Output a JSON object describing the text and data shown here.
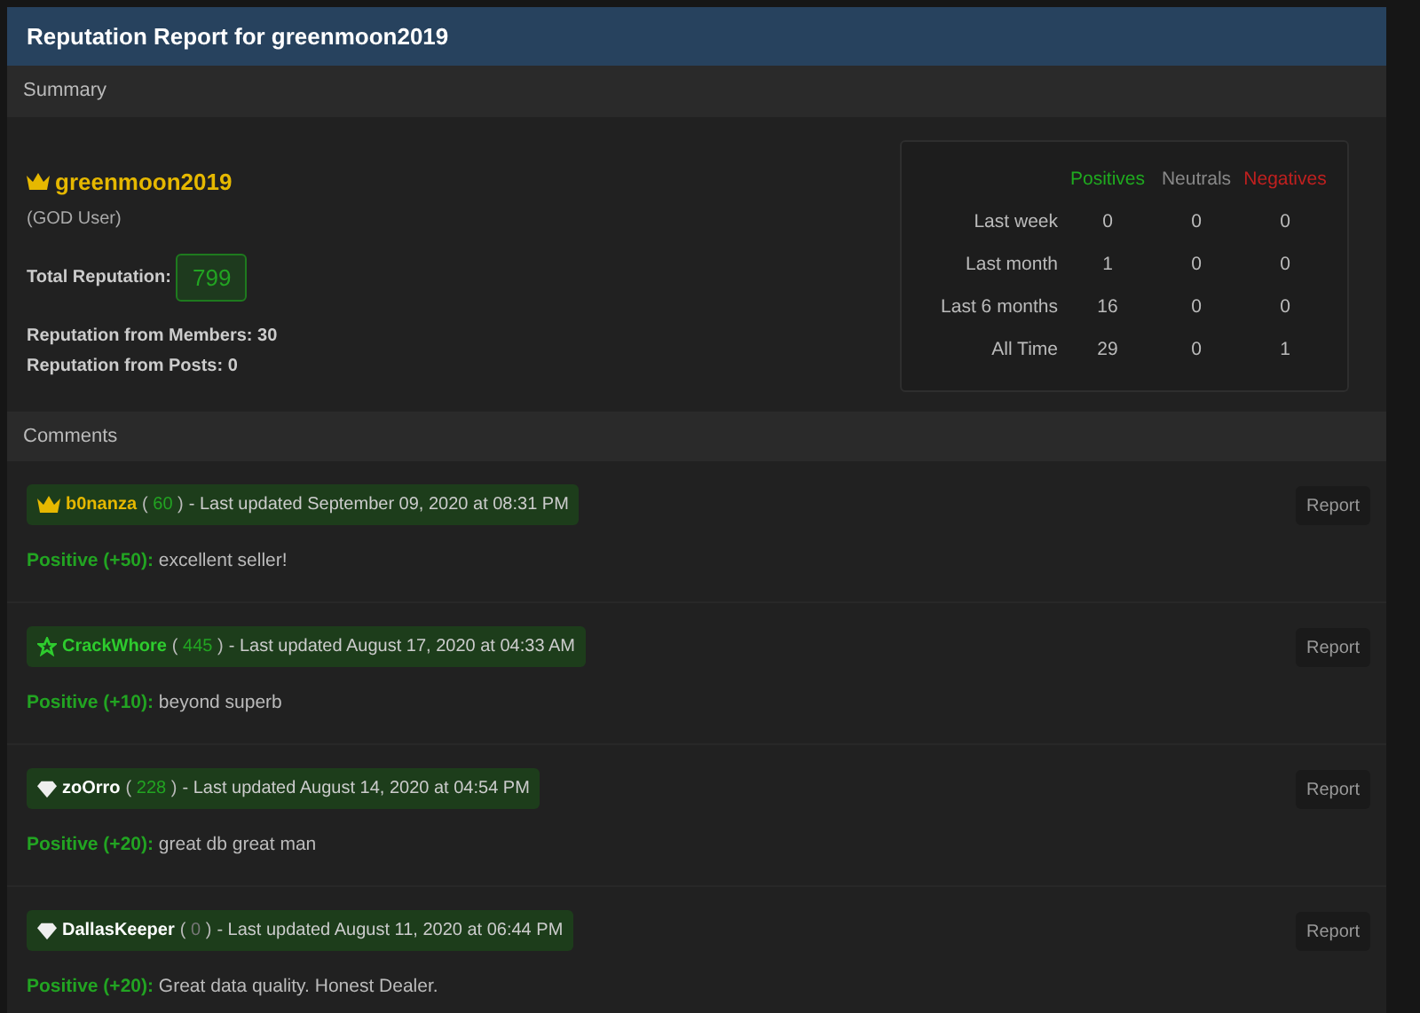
{
  "header": {
    "title": "Reputation Report for greenmoon2019"
  },
  "summary": {
    "title": "Summary",
    "user": {
      "kind": "crown",
      "name": "greenmoon2019",
      "rank": "(GOD User)"
    },
    "total_label": "Total Reputation:",
    "total": "799",
    "lines": [
      "Reputation from Members: 30",
      "Reputation from Posts: 0"
    ],
    "stats": {
      "columns": [
        {
          "label": "Positives",
          "kind": "positive"
        },
        {
          "label": "Neutrals",
          "kind": "neutral"
        },
        {
          "label": "Negatives",
          "kind": "negative"
        }
      ],
      "rows": [
        {
          "period": "Last week",
          "values": [
            "0",
            "0",
            "0"
          ]
        },
        {
          "period": "Last month",
          "values": [
            "1",
            "0",
            "0"
          ]
        },
        {
          "period": "Last 6 months",
          "values": [
            "16",
            "0",
            "0"
          ]
        },
        {
          "period": "All Time",
          "values": [
            "29",
            "0",
            "1"
          ]
        }
      ]
    }
  },
  "comments": {
    "title": "Comments",
    "items": [
      {
        "kind": "crown",
        "name": "b0nanza",
        "count": "60",
        "paren_open": "(",
        "paren_close": ")",
        "count_positive": true,
        "updated": "- Last updated September 09, 2020 at 08:31 PM",
        "rating": "Positive (+50):",
        "text": "excellent seller!",
        "action": "Report"
      },
      {
        "kind": "star",
        "name": "CrackWhore",
        "count": "445",
        "paren_open": "(",
        "paren_close": ")",
        "count_positive": true,
        "updated": "- Last updated August 17, 2020 at 04:33 AM",
        "rating": "Positive (+10):",
        "text": "beyond superb",
        "action": "Report"
      },
      {
        "kind": "diamond",
        "name": "zoOrro",
        "count": "228",
        "paren_open": "(",
        "paren_close": ")",
        "count_positive": true,
        "updated": "- Last updated August 14, 2020 at 04:54 PM",
        "rating": "Positive (+20):",
        "text": "great db great man",
        "action": "Report"
      },
      {
        "kind": "diamond",
        "name": "DallasKeeper",
        "count": "0",
        "paren_open": "(",
        "paren_close": ")",
        "count_positive": false,
        "updated": "- Last updated August 11, 2020 at 06:44 PM",
        "rating": "Positive (+20):",
        "text": "Great data quality. Honest Dealer.",
        "action": "Report"
      }
    ]
  }
}
